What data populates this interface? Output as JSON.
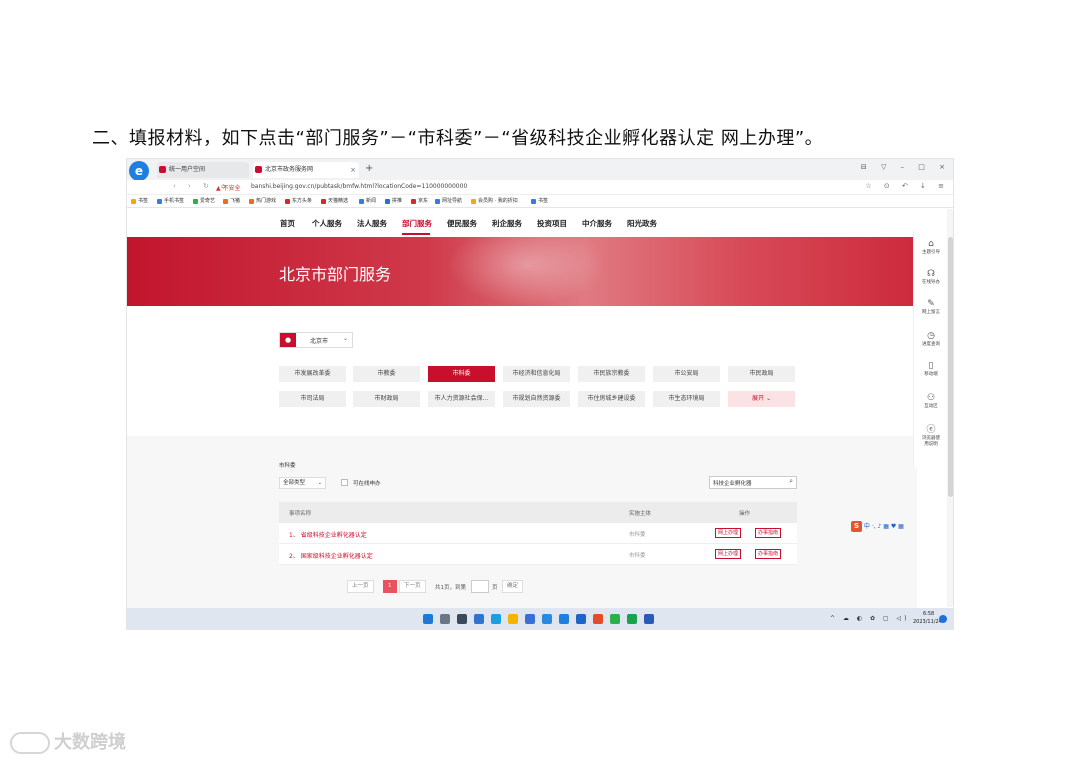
{
  "doc": {
    "heading": "二、填报材料，如下点击“部门服务”－“市科委”－“省级科技企业孵化器认定 网上办理”。"
  },
  "browser": {
    "tabs": [
      {
        "label": "统一用户空间"
      },
      {
        "label": "北京市政务服务网"
      }
    ],
    "new_tab": "+",
    "insecure_label": "不安全",
    "url": "banshi.beijing.gov.cn/pubtask/bmfw.html?locationCode=110000000000",
    "bookmarks": [
      "书签",
      "手机书签",
      "爱奇艺",
      "飞猪",
      "热门游戏",
      "东方头条",
      "天猫精选",
      "新闻",
      "拼推",
      "京东",
      "网址导航",
      "会员购 · 我的折扣",
      "书签"
    ]
  },
  "site": {
    "nav": [
      "首页",
      "个人服务",
      "法人服务",
      "部门服务",
      "便民服务",
      "利企服务",
      "投资项目",
      "中介服务",
      "阳光政务"
    ],
    "banner_title": "北京市部门服务",
    "region": "北京市",
    "departments_row1": [
      "市发展改革委",
      "市教委",
      "市科委",
      "市经济和信息化局",
      "市民族宗教委",
      "市公安局",
      "市民政局"
    ],
    "departments_row2": [
      "市司法局",
      "市财政局",
      "市人力资源社会保...",
      "市规划自然资源委",
      "市住房城乡建设委",
      "市生态环境局",
      "展开"
    ],
    "crumb": "市科委",
    "type_filter": "全部类型",
    "online_filter": "可在线申办",
    "search_value": "科技企业孵化器",
    "table": {
      "headers": [
        "事项名称",
        "实施主体",
        "操作"
      ],
      "rows": [
        {
          "name": "1、 省级科技企业孵化器认定",
          "dept": "市科委",
          "action1": "网上办理",
          "action2": "办事指南"
        },
        {
          "name": "2、 国家级科技企业孵化器认定",
          "dept": "市科委",
          "action1": "网上办理",
          "action2": "办事指南"
        }
      ]
    },
    "pager": {
      "prev": "上一页",
      "current": "1",
      "next": "下一页",
      "total": "共1页，到第",
      "unit": "页",
      "confirm": "确定"
    },
    "sidebar": [
      {
        "label": "主题引导",
        "icon": "⌂"
      },
      {
        "label": "在线导办",
        "icon": "☊"
      },
      {
        "label": "网上留言",
        "icon": "✎"
      },
      {
        "label": "进度查询",
        "icon": "◷"
      },
      {
        "label": "移动端",
        "icon": "▯"
      },
      {
        "label": "互动区",
        "icon": "⚇"
      },
      {
        "label": "浏览器使用说明",
        "icon": "ⓔ"
      }
    ]
  },
  "taskbar": {
    "time": "6:58",
    "date": "2023/11/24"
  },
  "watermark": "大数跨境",
  "colors": {
    "brand_red": "#c8102e",
    "taskbar": "#dfe6ef"
  }
}
